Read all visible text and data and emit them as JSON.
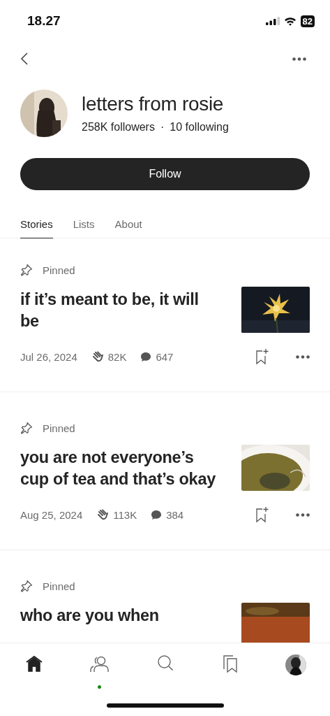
{
  "status_bar": {
    "time": "18.27",
    "battery": "82"
  },
  "profile": {
    "name": "letters from rosie",
    "followers": "258K followers",
    "separator": "·",
    "following": "10 following"
  },
  "follow_button": "Follow",
  "tabs": [
    {
      "label": "Stories",
      "selected": true
    },
    {
      "label": "Lists",
      "selected": false
    },
    {
      "label": "About",
      "selected": false
    }
  ],
  "stories": [
    {
      "pinned": "Pinned",
      "title": "if it’s meant to be, it will be",
      "date": "Jul 26, 2024",
      "claps": "82K",
      "comments": "647"
    },
    {
      "pinned": "Pinned",
      "title": "you are not everyone’s cup of tea and that’s okay",
      "date": "Aug 25, 2024",
      "claps": "113K",
      "comments": "384"
    },
    {
      "pinned": "Pinned",
      "title": "who are you when"
    }
  ],
  "tab_bar": [
    {
      "kind": "home",
      "selected": true
    },
    {
      "kind": "following",
      "selected": false,
      "dot": true
    },
    {
      "kind": "search",
      "selected": false
    },
    {
      "kind": "library",
      "selected": false
    },
    {
      "kind": "avatar",
      "selected": false
    }
  ]
}
